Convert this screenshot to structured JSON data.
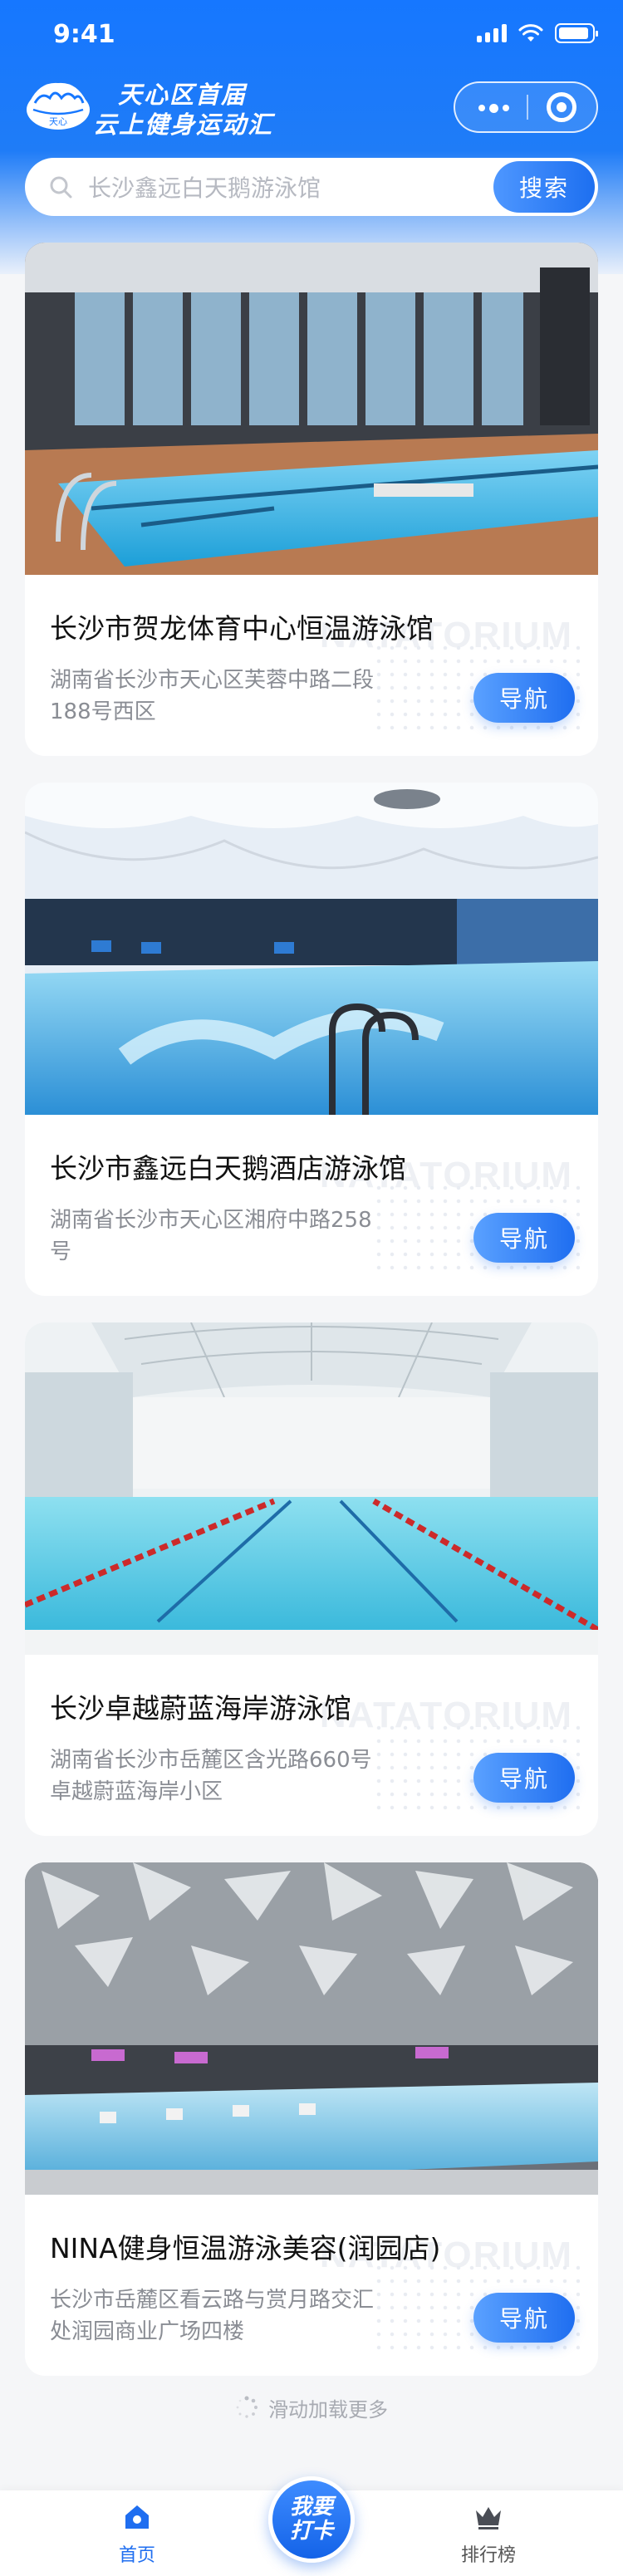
{
  "status_bar": {
    "time": "9:41"
  },
  "header": {
    "title_line1": "天心区首届",
    "title_line2": "云上健身运动汇",
    "logo_text": "天心"
  },
  "search": {
    "placeholder": "长沙鑫远白天鹅游泳馆",
    "button_label": "搜索"
  },
  "venues": [
    {
      "name": "长沙市贺龙体育中心恒温游泳馆",
      "address": "湖南省长沙市天心区芙蓉中路二段188号西区",
      "nav_label": "导航",
      "watermark": "NATATORIUM"
    },
    {
      "name": "长沙市鑫远白天鹅酒店游泳馆",
      "address": "湖南省长沙市天心区湘府中路258号",
      "nav_label": "导航",
      "watermark": "NATATORIUM"
    },
    {
      "name": "长沙卓越蔚蓝海岸游泳馆",
      "address": "湖南省长沙市岳麓区含光路660号卓越蔚蓝海岸小区",
      "nav_label": "导航",
      "watermark": "NATATORIUM"
    },
    {
      "name": "NINA健身恒温游泳美容(润园店)",
      "address": "长沙市岳麓区看云路与赏月路交汇处润园商业广场四楼",
      "nav_label": "导航",
      "watermark": "NATATORIUM"
    }
  ],
  "loading_text": "滑动加载更多",
  "tabbar": {
    "home_label": "首页",
    "checkin_line1": "我要",
    "checkin_line2": "打卡",
    "rank_label": "排行榜"
  },
  "colors": {
    "primary": "#1677ff",
    "accent_gradient_end": "#1f6ef0",
    "background": "#f5f6f8"
  }
}
